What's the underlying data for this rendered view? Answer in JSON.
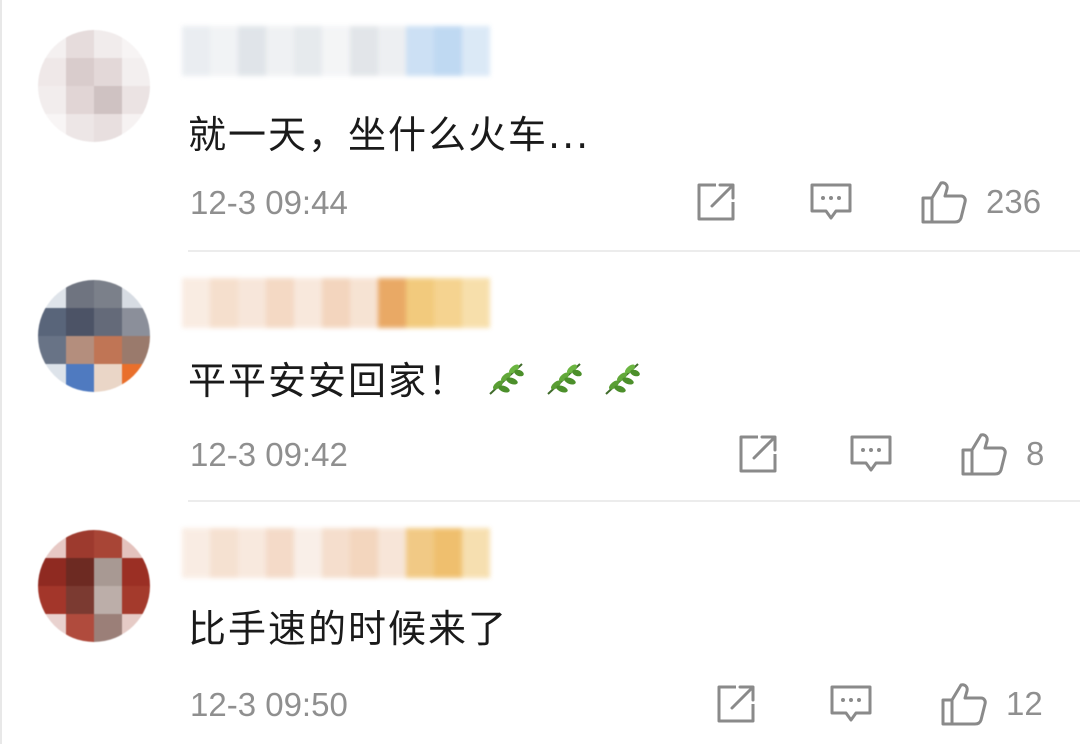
{
  "comments": [
    {
      "text": "就一天，坐什么火车...",
      "time": "12-3 09:44",
      "likes": "236",
      "emoji": []
    },
    {
      "text": "平平安安回家！",
      "time": "12-3 09:42",
      "likes": "8",
      "emoji": [
        "leaf-emoji",
        "leaf-emoji",
        "leaf-emoji"
      ]
    },
    {
      "text": "比手速的时候来了",
      "time": "12-3 09:50",
      "likes": "12",
      "emoji": []
    }
  ],
  "icons": {
    "share": "share-icon",
    "reply": "comment-icon",
    "like": "thumbs-up-icon"
  },
  "colors": {
    "text": "#1a1a1a",
    "meta": "#8f8f8f",
    "icon": "#8a8a8a",
    "divider": "#ececec",
    "leaf": "#3f8f2a"
  }
}
